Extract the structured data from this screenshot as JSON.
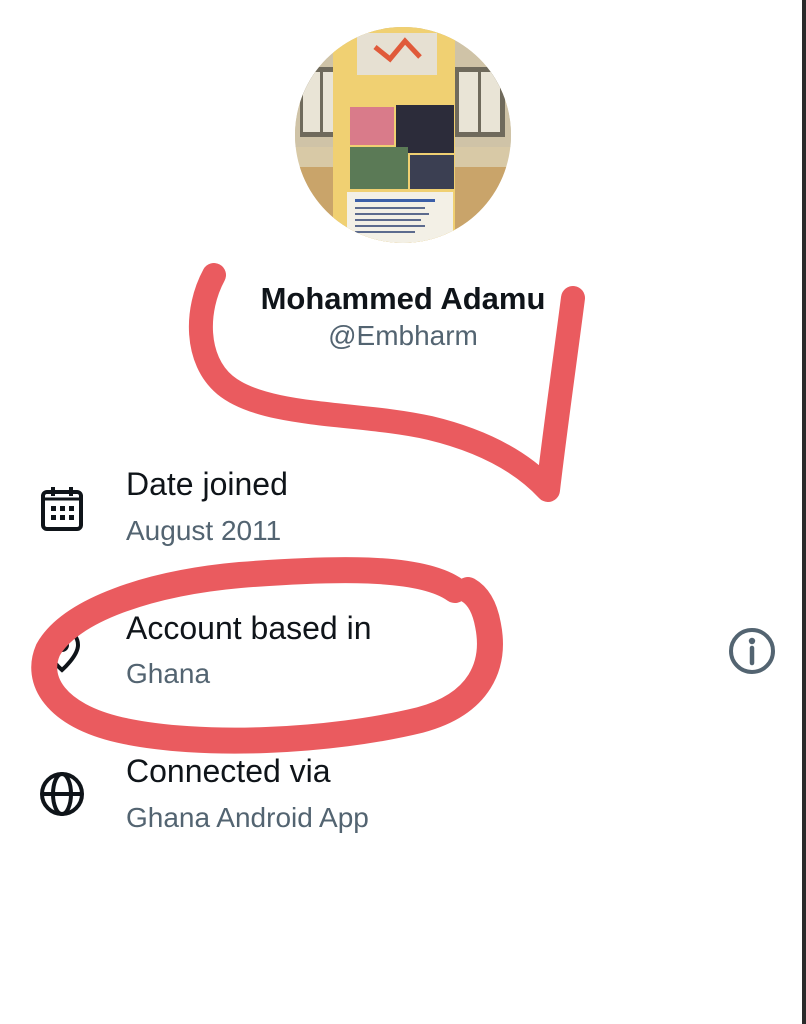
{
  "profile": {
    "name": "Mohammed Adamu",
    "handle": "@Embharm",
    "avatar_description": "profile photo of a printed banner"
  },
  "details": [
    {
      "title": "Date joined",
      "value": "August 2011",
      "icon": "calendar-icon"
    },
    {
      "title": "Account based in",
      "value": "Ghana",
      "icon": "location-icon",
      "trailing_icon": "info-icon"
    },
    {
      "title": "Connected via",
      "value": "Ghana Android App",
      "icon": "globe-icon"
    }
  ],
  "colors": {
    "primary_text": "#0f1419",
    "secondary_text": "#536471",
    "annotation_red": "#ea5b5f"
  }
}
